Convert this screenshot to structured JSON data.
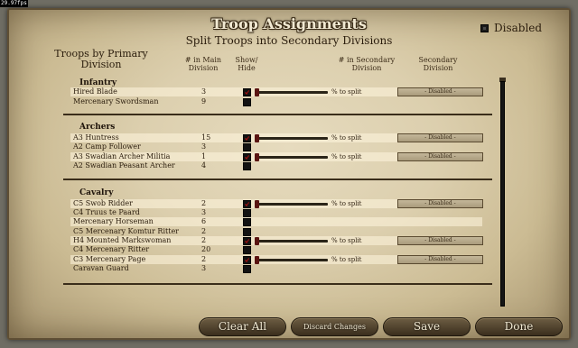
{
  "fps": "29.97fps",
  "title": "Troop Assignments",
  "subtitle": "Split Troops into Secondary Divisions",
  "disabled_label": "Disabled",
  "headers": {
    "troops": "Troops by Primary Division",
    "main_count": "# in Main Division",
    "show_hide": "Show/ Hide",
    "secondary_count": "# in Secondary Division",
    "secondary_div": "Secondary Division"
  },
  "pct_label": "% to split",
  "dropdown_value": "- Disabled -",
  "groups": {
    "infantry": "Infantry",
    "archers": "Archers",
    "cavalry": "Cavalry"
  },
  "infantry": [
    {
      "name": "Hired Blade",
      "count": "3"
    },
    {
      "name": "Mercenary Swordsman",
      "count": "9"
    }
  ],
  "archers": [
    {
      "name": "A3 Huntress",
      "count": "15"
    },
    {
      "name": "A2 Camp Follower",
      "count": "3"
    },
    {
      "name": "A3 Swadian Archer Militia",
      "count": "1"
    },
    {
      "name": "A2 Swadian Peasant Archer",
      "count": "4"
    }
  ],
  "cavalry": [
    {
      "name": "C5 Swob Ridder",
      "count": "2"
    },
    {
      "name": "C4 Truus te Paard",
      "count": "3"
    },
    {
      "name": "Mercenary Horseman",
      "count": "6"
    },
    {
      "name": "C5 Mercenary Komtur Ritter",
      "count": "2"
    },
    {
      "name": "H4 Mounted Markswoman",
      "count": "2"
    },
    {
      "name": "C4 Mercenary Ritter",
      "count": "20"
    },
    {
      "name": "C3 Mercenary Page",
      "count": "2"
    },
    {
      "name": "Caravan Guard",
      "count": "3"
    }
  ],
  "buttons": {
    "clear_all": "Clear All",
    "discard": "Discard Changes",
    "save": "Save",
    "done": "Done"
  }
}
